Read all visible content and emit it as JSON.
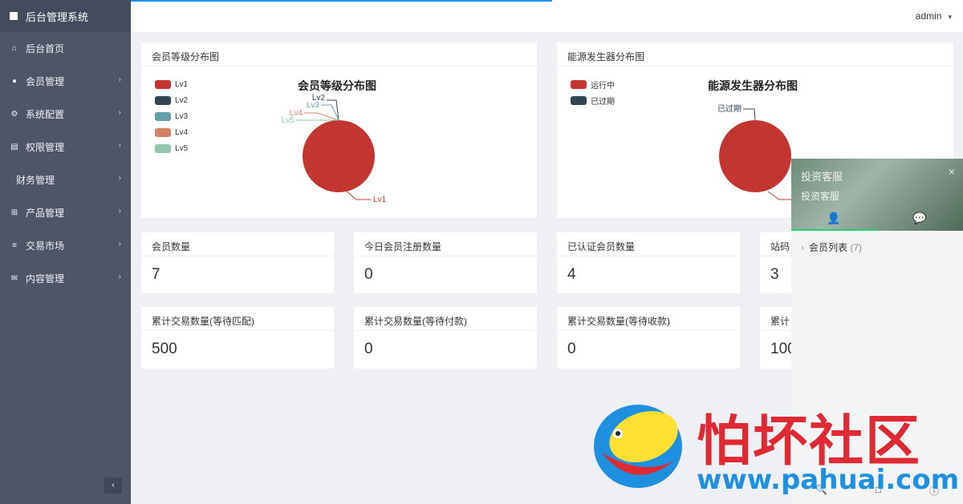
{
  "sidebar": {
    "title": "后台管理系统",
    "items": [
      {
        "label": "后台首页",
        "icon": "home-icon",
        "glyph": "⌂",
        "has_children": false
      },
      {
        "label": "会员管理",
        "icon": "user-icon",
        "glyph": "●",
        "has_children": true
      },
      {
        "label": "系统配置",
        "icon": "cogs-icon",
        "glyph": "⚙",
        "has_children": true
      },
      {
        "label": "权限管理",
        "icon": "table-icon",
        "glyph": "▤",
        "has_children": true
      },
      {
        "label": "财务管理",
        "icon": "",
        "glyph": "",
        "has_children": true
      },
      {
        "label": "产品管理",
        "icon": "windows-icon",
        "glyph": "⊞",
        "has_children": true
      },
      {
        "label": "交易市场",
        "icon": "list-icon",
        "glyph": "≡",
        "has_children": true
      },
      {
        "label": "内容管理",
        "icon": "envelope-icon",
        "glyph": "✉",
        "has_children": true
      }
    ],
    "collapse_glyph": "‹"
  },
  "topbar": {
    "user": "admin",
    "caret": "▾"
  },
  "panels": {
    "member_level": {
      "header": "会员等级分布图",
      "chart_title": "会员等级分布图"
    },
    "energy": {
      "header": "能源发生器分布图",
      "chart_title": "能源发生器分布图"
    }
  },
  "chart_data": [
    {
      "type": "pie",
      "title": "会员等级分布图",
      "legend": "top-left",
      "series": [
        {
          "name": "Lv1",
          "value": 7,
          "color": "#c23531"
        },
        {
          "name": "Lv2",
          "value": 0,
          "color": "#2f4554"
        },
        {
          "name": "Lv3",
          "value": 0,
          "color": "#61a0a8"
        },
        {
          "name": "Lv4",
          "value": 0,
          "color": "#d48265"
        },
        {
          "name": "Lv5",
          "value": 0,
          "color": "#91c7ae"
        }
      ]
    },
    {
      "type": "pie",
      "title": "能源发生器分布图",
      "legend": "top-left",
      "series": [
        {
          "name": "运行中",
          "value": 1,
          "color": "#c23531"
        },
        {
          "name": "已过期",
          "value": 0,
          "color": "#2f4554"
        }
      ]
    }
  ],
  "stats_row1": [
    {
      "label": "会员数量",
      "value": "7"
    },
    {
      "label": "今日会员注册数量",
      "value": "0"
    },
    {
      "label": "已认证会员数量",
      "value": "4"
    },
    {
      "label": "站码",
      "value": "3"
    }
  ],
  "stats_row2": [
    {
      "label": "累计交易数量(等待匹配)",
      "value": "500"
    },
    {
      "label": "累计交易数量(等待付款)",
      "value": "0"
    },
    {
      "label": "累计交易数量(等待收款)",
      "value": "0"
    },
    {
      "label": "累计",
      "value": "100"
    }
  ],
  "chat": {
    "title": "投资客服",
    "subtitle": "投资客服",
    "close": "×",
    "tab_user_glyph": "👤",
    "tab_chat_glyph": "💬",
    "list_label": "会员列表",
    "list_count": "(7)",
    "list_chevron": "›",
    "bottom": [
      "🔍",
      "□",
      "ⓘ"
    ]
  },
  "watermark": {
    "text": "怕坏社区",
    "url": "www.pahuai.com"
  }
}
